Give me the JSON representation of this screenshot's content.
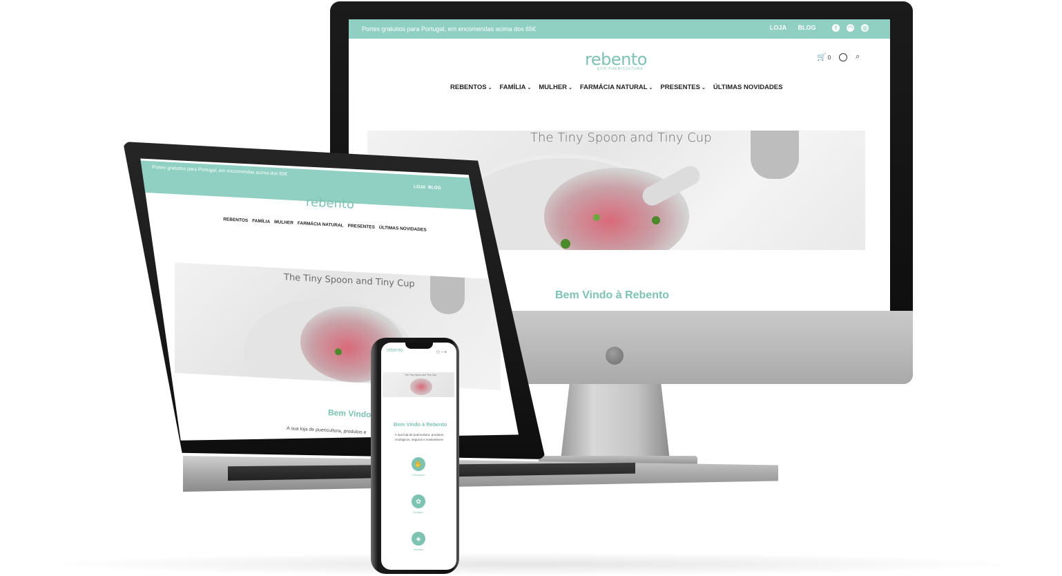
{
  "site": {
    "promo_text": "Portes gratuitos para Portugal, em encomendas acima dos 65€",
    "promo_text_short": "Portes gratuitos para Portugal, em encomendas acima dos 65€",
    "top_links": [
      "LOJA",
      "BLOG"
    ],
    "social_icons": [
      "facebook-icon",
      "messenger-icon",
      "instagram-icon"
    ],
    "logo_text": "rebento",
    "logo_subtitle": "ECO PUERICULTURA",
    "cart_count": "0",
    "nav": [
      "REBENTOS",
      "FAMÍLIA",
      "MULHER",
      "FARMÁCIA NATURAL",
      "PRESENTES",
      "ÚLTIMAS NOVIDADES"
    ],
    "hero_title": "The Tiny Spoon and Tiny Cup",
    "welcome_title": "Bem Vindo à Rebento",
    "welcome_text": "A sua loja de puericultura, produtos ecológicos, seguros e sustentáveis",
    "welcome_text_partial": "A sua loja de puericultura, produtos e",
    "welcome_title_partial": "Bem Vindo à",
    "features": [
      {
        "label": "Puericultura",
        "icon": "hand-drop-icon"
      },
      {
        "label": "Biológico",
        "icon": "plant-icon"
      },
      {
        "label": "Saudável",
        "icon": "bottle-icon"
      }
    ]
  },
  "colors": {
    "accent": "#8fd0c2",
    "logo": "#7cc3b1",
    "text": "#222222"
  }
}
